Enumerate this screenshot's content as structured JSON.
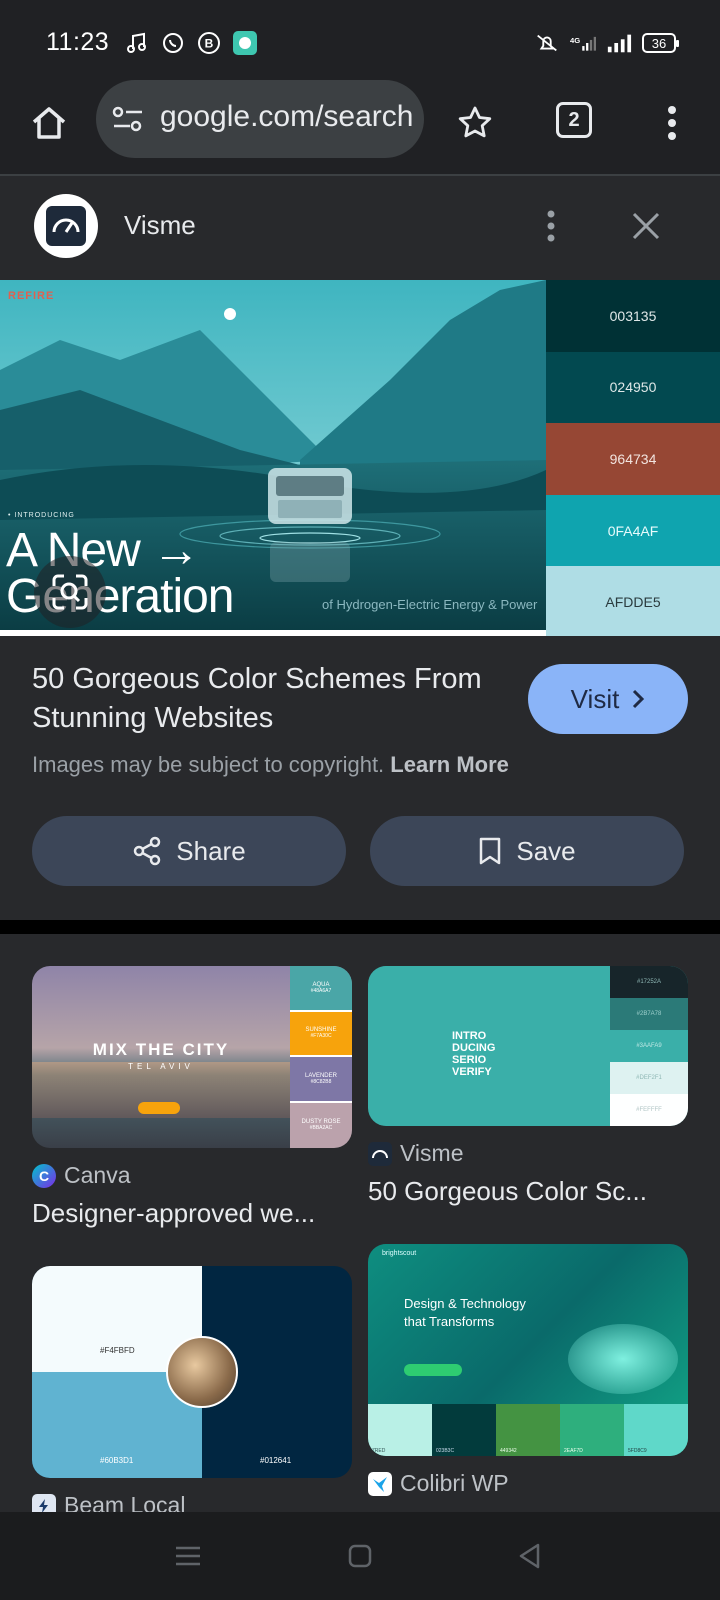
{
  "status_bar": {
    "time": "11:23",
    "battery": "36",
    "network": "4G",
    "left_icons": [
      "music-note-icon",
      "whatsapp-icon",
      "b-app-icon",
      "green-app-icon"
    ],
    "right_icons": [
      "mute-icon",
      "signal-4g-icon",
      "signal-icon",
      "battery-icon"
    ]
  },
  "toolbar": {
    "url": "google.com/search",
    "tab_count": "2"
  },
  "viewer": {
    "source_name": "Visme",
    "image": {
      "brand": "REFIRE",
      "intro": "• INTRODUCING",
      "headline_line1": "A New →",
      "headline_line2": "Generation",
      "subline": "of Hydrogen-Electric Energy & Power",
      "palette": [
        {
          "hex": "003135",
          "color": "#003135",
          "text_color": "#dfe8e8"
        },
        {
          "hex": "024950",
          "color": "#024950",
          "text_color": "#dfe8e8"
        },
        {
          "hex": "964734",
          "color": "#964734",
          "text_color": "#f2e4df"
        },
        {
          "hex": "0FA4AF",
          "color": "#0fa4af",
          "text_color": "#e8fbfc"
        },
        {
          "hex": "AFDDE5",
          "color": "#afdde5",
          "text_color": "#2a3b3e"
        }
      ]
    },
    "title": "50 Gorgeous Color Schemes From Stunning Websites",
    "visit_label": "Visit",
    "copyright_text": "Images may be subject to copyright.",
    "learn_more": "Learn More",
    "share_label": "Share",
    "save_label": "Save"
  },
  "results": [
    {
      "source": "Canva",
      "title": "Designer-approved we...",
      "thumb": {
        "headline": "MIX THE CITY",
        "subline": "TEL AVIV",
        "swatches": [
          {
            "name": "AQUA",
            "hex": "#48A6A7",
            "color": "#4aa6a7"
          },
          {
            "name": "SUNSHINE",
            "hex": "#F7A30C",
            "color": "#f7a30c"
          },
          {
            "name": "LAVENDER",
            "hex": "#8C82B8",
            "color": "#7e77a6"
          },
          {
            "name": "DUSTY ROSE",
            "hex": "#BBA2AC",
            "color": "#bba2ac"
          }
        ]
      }
    },
    {
      "source": "Visme",
      "title": "50 Gorgeous Color Sc...",
      "thumb": {
        "headline": "INTRO DUCING SERIO VERIFY",
        "swatches": [
          {
            "hex": "#17252A",
            "color": "#17252a"
          },
          {
            "hex": "#2B7A78",
            "color": "#2b7a78"
          },
          {
            "hex": "#3AAFA9",
            "color": "#3aafa9"
          },
          {
            "hex": "#DEF2F1",
            "color": "#def2f1"
          },
          {
            "hex": "#FEFFFF",
            "color": "#feffff"
          }
        ]
      }
    },
    {
      "source": "Beam Local",
      "title": "",
      "thumb": {
        "left_hex": "#F4FBFD",
        "left_bottom_hex": "#60B3D1",
        "right_hex": "#012641"
      }
    },
    {
      "source": "Colibri WP",
      "title": "",
      "thumb": {
        "brand": "brightscout",
        "headline_line1": "Design & Technology",
        "headline_line2": "that Transforms",
        "swatches": [
          {
            "hex": "7RED",
            "color": "#b9f0e6"
          },
          {
            "hex": "023B3C",
            "color": "#023b3c"
          },
          {
            "hex": "449342",
            "color": "#449342"
          },
          {
            "hex": "2EAF7D",
            "color": "#2eaf7d"
          },
          {
            "hex": "5FD8C9",
            "color": "#5fd8c9"
          }
        ]
      }
    }
  ],
  "nav": [
    "recents-icon",
    "home-square-icon",
    "back-triangle-icon"
  ]
}
